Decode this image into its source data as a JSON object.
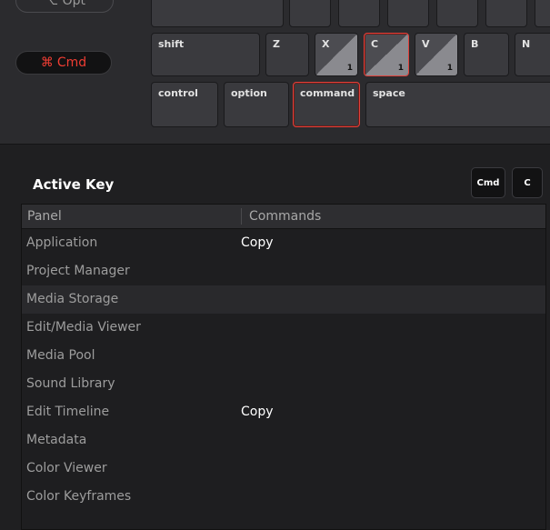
{
  "keyboard": {
    "option_modifier_label": "⌥ Opt",
    "cmd_modifier": {
      "symbol": "⌘",
      "label": "Cmd"
    },
    "keys": {
      "shift": "shift",
      "z": "Z",
      "x": "X",
      "c": "C",
      "v": "V",
      "b": "B",
      "n": "N",
      "control": "control",
      "option": "option",
      "command": "command",
      "space": "space"
    },
    "counts": {
      "x": "1",
      "c": "1",
      "v": "1"
    }
  },
  "active_key": {
    "title": "Active Key",
    "chips": [
      "Cmd",
      "C"
    ]
  },
  "table": {
    "headers": {
      "panel": "Panel",
      "commands": "Commands"
    },
    "rows": [
      {
        "panel": "Application",
        "command": "Copy"
      },
      {
        "panel": "Project Manager",
        "command": ""
      },
      {
        "panel": "Media Storage",
        "command": ""
      },
      {
        "panel": "Edit/Media Viewer",
        "command": ""
      },
      {
        "panel": "Media Pool",
        "command": ""
      },
      {
        "panel": "Sound Library",
        "command": ""
      },
      {
        "panel": "Edit Timeline",
        "command": "Copy"
      },
      {
        "panel": "Metadata",
        "command": ""
      },
      {
        "panel": "Color Viewer",
        "command": ""
      },
      {
        "panel": "Color Keyframes",
        "command": ""
      }
    ],
    "selected_row": 2
  },
  "colors": {
    "accent_red": "#e0413a",
    "cmd_text_red": "#ef3d33",
    "background": "#1f1f21"
  }
}
